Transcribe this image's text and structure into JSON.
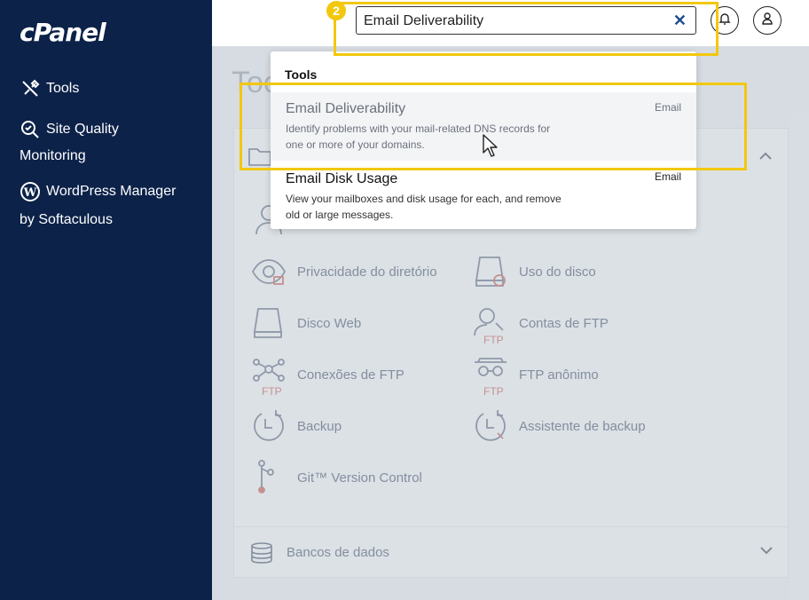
{
  "brand": "cPanel",
  "sidebar": {
    "items": [
      {
        "label": "Tools",
        "icon": "tools-icon"
      },
      {
        "label": "Site Quality",
        "label2": "Monitoring",
        "icon": "site-quality-icon"
      },
      {
        "label": "WordPress Manager",
        "label2": "by Softaculous",
        "icon": "wordpress-icon"
      }
    ]
  },
  "header": {
    "search_value": "Email Deliverability",
    "clear_icon": "close-icon",
    "notifications_icon": "bell-icon",
    "user_icon": "user-icon"
  },
  "step_badge": "2",
  "dropdown": {
    "section": "Tools",
    "results": [
      {
        "title": "Email Deliverability",
        "desc": "Identify problems with your mail-related DNS records for one or more of your domains.",
        "category": "Email"
      },
      {
        "title": "Email Disk Usage",
        "desc": "View your mailboxes and disk usage for each, and remove old or large messages.",
        "category": "Email"
      }
    ]
  },
  "main": {
    "page_title": "Too",
    "tools": [
      {
        "label": "Privacidade do diretório",
        "icon": "eye-icon"
      },
      {
        "label": "Uso do disco",
        "icon": "disk-usage-icon"
      },
      {
        "label": "Disco Web",
        "icon": "web-disk-icon"
      },
      {
        "label": "Contas de FTP",
        "icon": "ftp-accounts-icon",
        "tag": "FTP"
      },
      {
        "label": "Conexões de FTP",
        "icon": "ftp-connections-icon",
        "tag": "FTP"
      },
      {
        "label": "FTP anônimo",
        "icon": "anonymous-ftp-icon",
        "tag": "FTP"
      },
      {
        "label": "Backup",
        "icon": "backup-icon"
      },
      {
        "label": "Assistente de backup",
        "icon": "backup-wizard-icon"
      },
      {
        "label": "Git™ Version Control",
        "icon": "git-icon"
      }
    ],
    "db_section": "Bancos de dados"
  },
  "colors": {
    "sidebar": "#0c2249",
    "callout": "#f2c80f",
    "accent": "#1d4d8f"
  }
}
